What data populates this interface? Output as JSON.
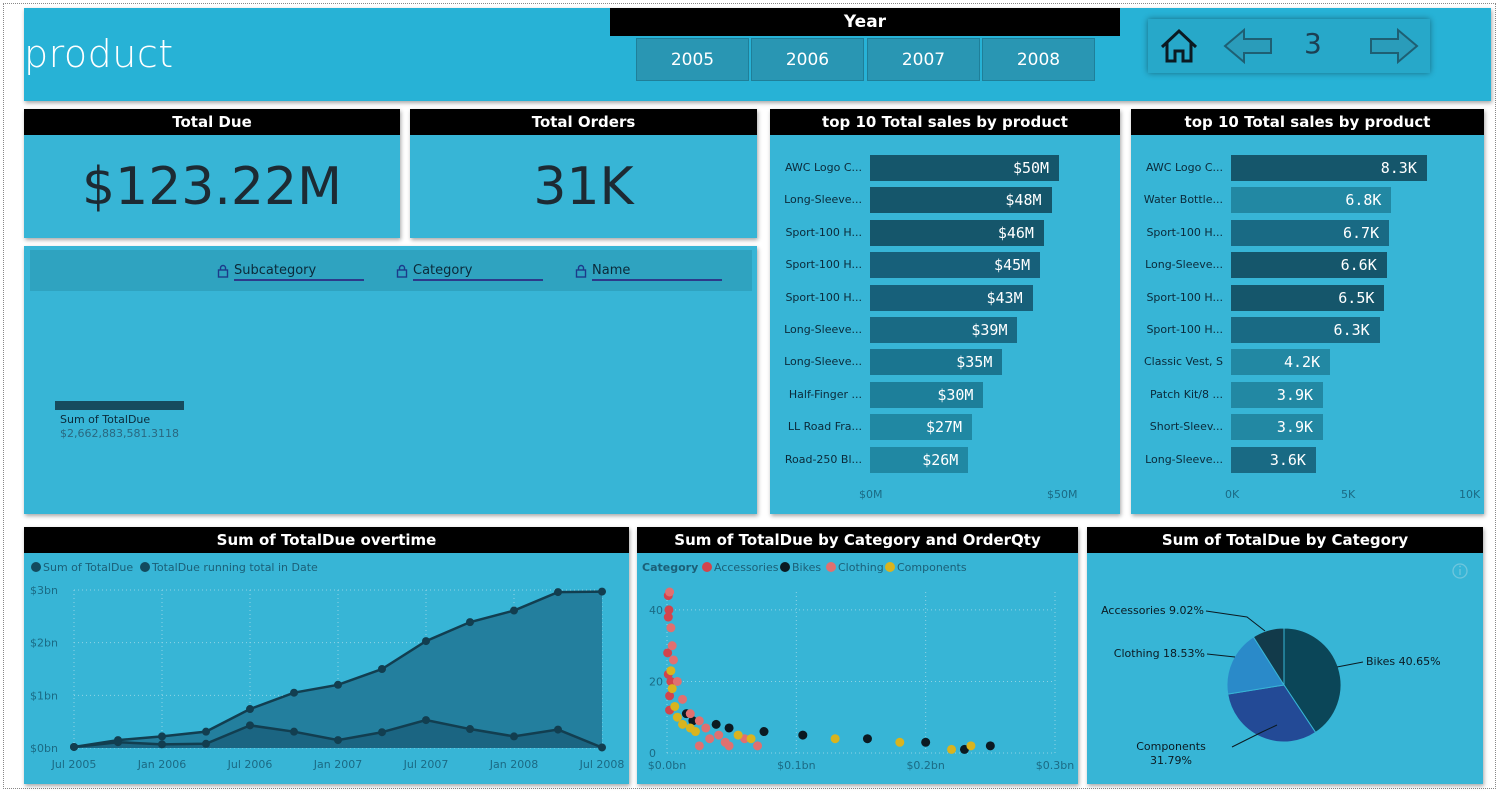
{
  "header": {
    "title": "product",
    "year_slicer": {
      "title": "Year",
      "options": [
        "2005",
        "2006",
        "2007",
        "2008"
      ]
    },
    "nav": {
      "page_number": "3"
    }
  },
  "kpis": {
    "total_due": {
      "title": "Total Due",
      "value": "$123.22M"
    },
    "total_orders": {
      "title": "Total Orders",
      "value": "31K"
    }
  },
  "table_slicer": {
    "columns": [
      "Subcategory",
      "Category",
      "Name"
    ],
    "measure_label": "Sum of TotalDue",
    "measure_value": "$2,662,883,581.3118"
  },
  "colors": {
    "panel_bg": "#37b5d6",
    "bar_dark": "#15566b",
    "bar_mid": "#1a6e86",
    "bar_light": "#2288a3",
    "bikes": "#0b4658",
    "components": "#234a96",
    "clothing": "#2a8ac9",
    "accessories": "#123a4a"
  },
  "chart_data": [
    {
      "type": "bar",
      "title": "top 10 Total sales by product",
      "categories": [
        "AWC Logo C...",
        "Long-Sleeve...",
        "Sport-100 H...",
        "Sport-100 H...",
        "Sport-100 H...",
        "Long-Sleeve...",
        "Long-Sleeve...",
        "Half-Finger ...",
        "LL Road Fra...",
        "Road-250 Bl..."
      ],
      "values": [
        50,
        48,
        46,
        45,
        43,
        39,
        35,
        30,
        27,
        26
      ],
      "labels": [
        "$50M",
        "$48M",
        "$46M",
        "$45M",
        "$43M",
        "$39M",
        "$35M",
        "$30M",
        "$27M",
        "$26M"
      ],
      "x_ticks": [
        "$0M",
        "$50M"
      ],
      "xlim": [
        0,
        55
      ]
    },
    {
      "type": "bar",
      "title": "top 10 Total sales by product",
      "categories": [
        "AWC Logo C...",
        "Water Bottle...",
        "Sport-100 H...",
        "Long-Sleeve...",
        "Sport-100 H...",
        "Sport-100 H...",
        "Classic Vest, S",
        "Patch Kit/8 ...",
        "Short-Sleev...",
        "Long-Sleeve..."
      ],
      "values": [
        8.3,
        6.8,
        6.7,
        6.6,
        6.5,
        6.3,
        4.2,
        3.9,
        3.9,
        3.6
      ],
      "labels": [
        "8.3K",
        "6.8K",
        "6.7K",
        "6.6K",
        "6.5K",
        "6.3K",
        "4.2K",
        "3.9K",
        "3.9K",
        "3.6K"
      ],
      "x_ticks": [
        "0K",
        "5K",
        "10K"
      ],
      "xlim": [
        0,
        10
      ]
    },
    {
      "type": "area",
      "title": "Sum of TotalDue overtime",
      "legend": [
        "Sum of TotalDue",
        "TotalDue running total in Date"
      ],
      "x": [
        "Jul 2005",
        "Oct 2005",
        "Jan 2006",
        "Apr 2006",
        "Jul 2006",
        "Oct 2006",
        "Jan 2007",
        "Apr 2007",
        "Jul 2007",
        "Oct 2007",
        "Jan 2008",
        "Apr 2008",
        "Jul 2008"
      ],
      "x_ticks": [
        "Jul 2005",
        "Jan 2006",
        "Jul 2006",
        "Jan 2007",
        "Jul 2007",
        "Jan 2008",
        "Jul 2008"
      ],
      "y_ticks": [
        "$0bn",
        "$1bn",
        "$2bn",
        "$3bn"
      ],
      "ylim": [
        0,
        3
      ],
      "series": [
        {
          "name": "Sum of TotalDue",
          "values": [
            0.02,
            0.11,
            0.07,
            0.08,
            0.43,
            0.31,
            0.15,
            0.3,
            0.53,
            0.36,
            0.22,
            0.35,
            0.01
          ]
        },
        {
          "name": "TotalDue running total in Date",
          "values": [
            0.02,
            0.15,
            0.22,
            0.31,
            0.74,
            1.05,
            1.2,
            1.5,
            2.03,
            2.39,
            2.61,
            2.96,
            2.97
          ]
        }
      ]
    },
    {
      "type": "scatter",
      "title": "Sum of TotalDue by Category and OrderQty",
      "legend_title": "Category",
      "legend": [
        "Accessories",
        "Bikes",
        "Clothing",
        "Components"
      ],
      "series_colors": [
        "#d2444c",
        "#0b1a22",
        "#e07070",
        "#d9b41e"
      ],
      "x_ticks": [
        "$0.0bn",
        "$0.1bn",
        "$0.2bn",
        "$0.3bn"
      ],
      "y_ticks": [
        "0",
        "20",
        "40"
      ],
      "xlim": [
        0,
        0.3
      ],
      "ylim": [
        0,
        45
      ],
      "series": [
        {
          "name": "Accessories",
          "points": [
            [
              0.0005,
              28
            ],
            [
              0.001,
              22
            ],
            [
              0.002,
              16
            ],
            [
              0.001,
              38
            ],
            [
              0.002,
              12
            ],
            [
              0.0015,
              40
            ],
            [
              0.001,
              44
            ],
            [
              0.003,
              20
            ]
          ]
        },
        {
          "name": "Bikes",
          "points": [
            [
              0.015,
              11
            ],
            [
              0.02,
              9
            ],
            [
              0.038,
              8
            ],
            [
              0.048,
              7
            ],
            [
              0.075,
              6
            ],
            [
              0.105,
              5
            ],
            [
              0.155,
              4
            ],
            [
              0.2,
              3
            ],
            [
              0.23,
              1
            ],
            [
              0.25,
              2
            ]
          ]
        },
        {
          "name": "Clothing",
          "points": [
            [
              0.002,
              45
            ],
            [
              0.003,
              35
            ],
            [
              0.004,
              30
            ],
            [
              0.005,
              26
            ],
            [
              0.008,
              20
            ],
            [
              0.012,
              15
            ],
            [
              0.018,
              11
            ],
            [
              0.025,
              9
            ],
            [
              0.03,
              7
            ],
            [
              0.04,
              5
            ],
            [
              0.045,
              3
            ],
            [
              0.06,
              4
            ],
            [
              0.025,
              2
            ],
            [
              0.033,
              4
            ],
            [
              0.07,
              2
            ],
            [
              0.048,
              2
            ]
          ]
        },
        {
          "name": "Components",
          "points": [
            [
              0.003,
              23
            ],
            [
              0.004,
              18
            ],
            [
              0.006,
              13
            ],
            [
              0.008,
              10
            ],
            [
              0.012,
              8
            ],
            [
              0.018,
              7
            ],
            [
              0.022,
              6
            ],
            [
              0.055,
              5
            ],
            [
              0.065,
              4
            ],
            [
              0.13,
              4
            ],
            [
              0.18,
              3
            ],
            [
              0.22,
              1
            ],
            [
              0.235,
              2
            ]
          ]
        }
      ]
    },
    {
      "type": "pie",
      "title": "Sum of TotalDue by Category",
      "slices": [
        {
          "label": "Bikes",
          "value": 40.65,
          "text": "Bikes 40.65%"
        },
        {
          "label": "Components",
          "value": 31.79,
          "text": "Components 31.79%"
        },
        {
          "label": "Clothing",
          "value": 18.53,
          "text": "Clothing 18.53%"
        },
        {
          "label": "Accessories",
          "value": 9.02,
          "text": "Accessories 9.02%"
        }
      ]
    }
  ]
}
